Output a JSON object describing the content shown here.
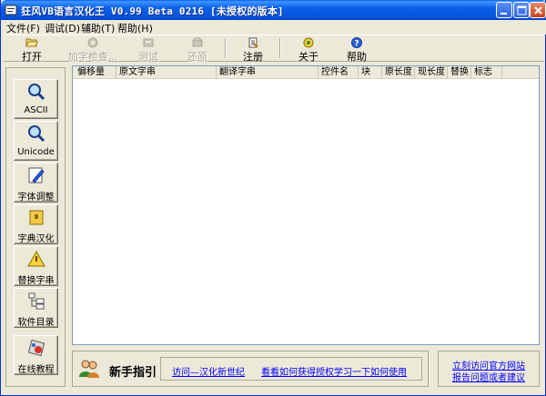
{
  "window": {
    "title": "狂风VB语言汉化王 V0.99 Beta 0216      [未授权的版本]"
  },
  "menu": [
    {
      "label": "文件(F)"
    },
    {
      "label": "调试(D)"
    },
    {
      "label": "辅助(T)"
    },
    {
      "label": "帮助(H)"
    }
  ],
  "toolbar": [
    {
      "label": "打开",
      "icon": "folder-open-icon",
      "enabled": true
    },
    {
      "label": "加字检查...",
      "icon": "check-icon",
      "enabled": false
    },
    {
      "label": "测试",
      "icon": "test-icon",
      "enabled": false
    },
    {
      "label": "还原",
      "icon": "restore-icon",
      "enabled": false
    },
    {
      "label": "注册",
      "icon": "register-icon",
      "enabled": true
    },
    {
      "label": "关于",
      "icon": "about-icon",
      "enabled": true
    },
    {
      "label": "帮助",
      "icon": "help-icon",
      "enabled": true
    }
  ],
  "sidebar": [
    {
      "label": "ASCII",
      "icon": "magnifier-icon"
    },
    {
      "label": "Unicode",
      "icon": "magnifier-icon"
    },
    {
      "label": "字体调整",
      "icon": "pencil-icon"
    },
    {
      "label": "字典汉化",
      "icon": "lock-icon"
    },
    {
      "label": "替换字串",
      "icon": "warning-icon"
    },
    {
      "label": "软件目录",
      "icon": "folder-tree-icon"
    },
    {
      "label": "在线教程",
      "icon": "online-icon"
    }
  ],
  "list": {
    "columns": [
      "偏移量",
      "原文字串",
      "翻译字串",
      "控件名",
      "块",
      "原长度",
      "现长度",
      "替换",
      "标志"
    ],
    "rows": []
  },
  "guide": {
    "title": "新手指引",
    "links": [
      "访问—汉化新世纪",
      "看看如何获得授权",
      "学习一下如何使用"
    ]
  },
  "side_links": [
    "立刻访问官方网站",
    "报告问题或者建议"
  ],
  "colors": {
    "titlebar": "#0a5fe8",
    "link": "#0000ff",
    "face": "#ece9d8"
  }
}
